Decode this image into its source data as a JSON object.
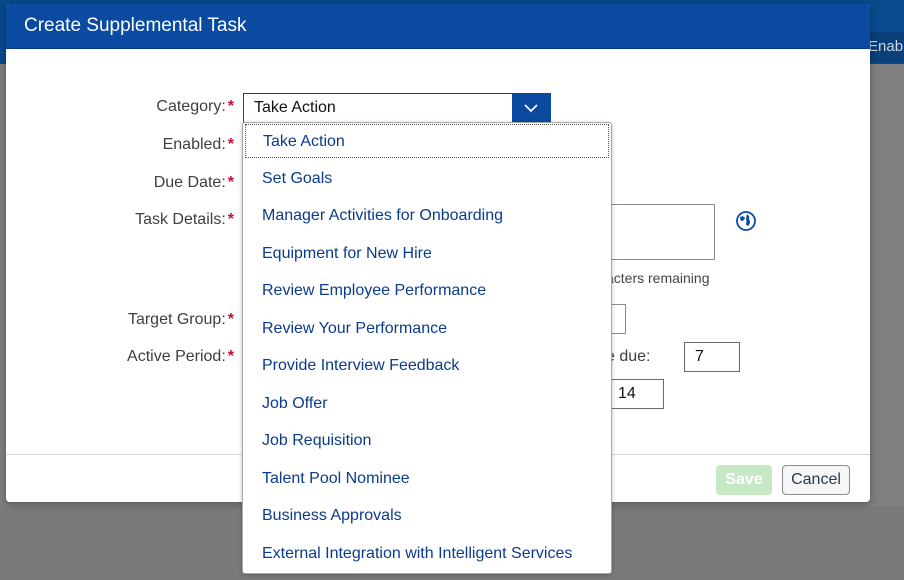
{
  "background": {
    "enable_button_label": "Enab"
  },
  "dialog": {
    "title": "Create Supplemental Task",
    "required_marker": "*",
    "labels": {
      "category": "Category:",
      "enabled": "Enabled:",
      "due_date": "Due Date:",
      "task_details": "Task Details:",
      "target_group": "Target Group:",
      "active_period": "Active Period:"
    },
    "category_select": {
      "value": "Take Action"
    },
    "task_details": {
      "chars_remaining_text": "acters remaining"
    },
    "active_period": {
      "before_due_label": "e due:",
      "before_due_value": "7",
      "after_due_value": "14"
    },
    "footer": {
      "save_label": "Save",
      "cancel_label": "Cancel"
    }
  },
  "dropdown": {
    "options": [
      "Take Action",
      "Set Goals",
      "Manager Activities for Onboarding",
      "Equipment for New Hire",
      "Review Employee Performance",
      "Review Your Performance",
      "Provide Interview Feedback",
      "Job Offer",
      "Job Requisition",
      "Talent Pool Nominee",
      "Business Approvals",
      "External Integration with Intelligent Services"
    ]
  },
  "colors": {
    "header": "#0a4aa0",
    "link": "#0a3b8c",
    "required": "#c8102e",
    "save_disabled": "#c7e8c5"
  }
}
